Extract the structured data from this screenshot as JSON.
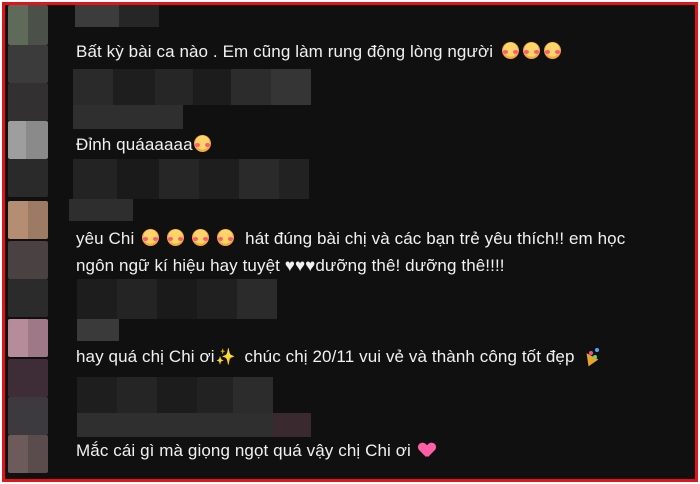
{
  "comments": [
    {
      "text": "Bất kỳ bài ca nào . Em cũng làm rung động lòng người",
      "emoji_count": 3
    },
    {
      "text": "Đỉnh quáaaaaa",
      "emoji_count": 1
    },
    {
      "line1": "yêu Chi",
      "line1_after": "hát đúng bài chị và các bạn trẻ yêu thích!! em học",
      "line2": "ngôn ngữ kí hiệu hay tuyệt ♥♥♥dưỡng thê! dưỡng thê!!!!",
      "emoji_count": 4
    },
    {
      "text": "hay quá chị Chi ơi",
      "text_after": "chúc chị 20/11 vui vẻ và thành công tốt đẹp"
    },
    {
      "text": "Mắc cái gì mà giọng ngọt quá vậy chị Chi ơi"
    }
  ],
  "icons": {
    "emoji": "smiling-face-with-hearts-icon",
    "sparkle": "sparkles-icon",
    "party": "party-popper-icon",
    "heart": "pink-heart-icon"
  },
  "colors": {
    "background": "#101010",
    "text": "#f1f1f1",
    "frame_border": "#e3131b"
  }
}
